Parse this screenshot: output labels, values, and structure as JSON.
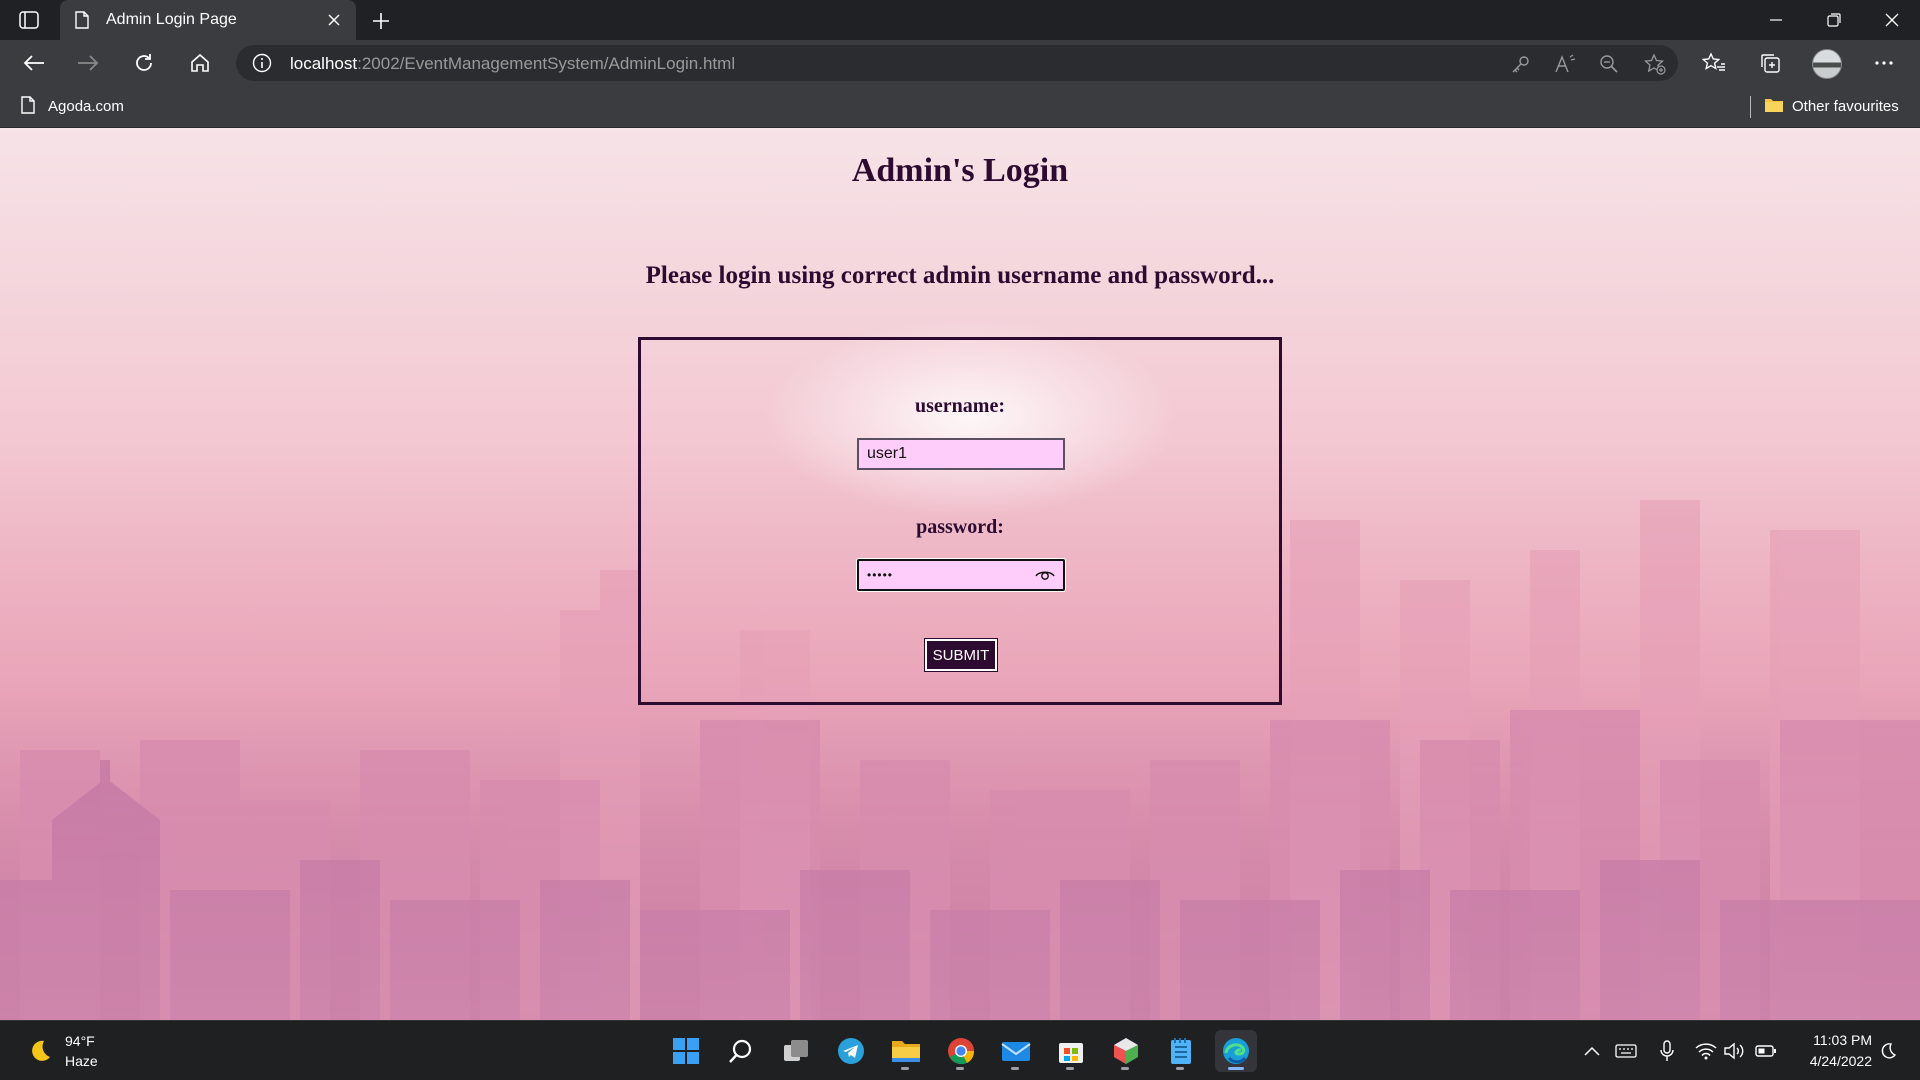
{
  "browser": {
    "tab": {
      "title": "Admin Login Page"
    },
    "address": {
      "host": "localhost",
      "path": ":2002/EventManagementSystem/AdminLogin.html"
    },
    "favorites": {
      "item": "Agoda.com",
      "other": "Other favourites"
    }
  },
  "page": {
    "title": "Admin's Login",
    "subtitle": "Please login using correct admin username and password...",
    "form": {
      "username_label": "username:",
      "username_value": "user1",
      "password_label": "password:",
      "password_value": "•••••",
      "submit_label": "SUBMIT"
    }
  },
  "taskbar": {
    "weather": {
      "temp": "94°F",
      "desc": "Haze"
    },
    "clock": {
      "time": "11:03 PM",
      "date": "4/24/2022"
    },
    "apps": [
      "start",
      "search",
      "task-view",
      "telegram",
      "file-explorer",
      "chrome",
      "mail",
      "microsoft-store",
      "app",
      "notepad",
      "edge"
    ]
  },
  "colors": {
    "accent": "#2d0a30",
    "input_bg": "#ffcdf9",
    "chrome_dark": "#202124",
    "chrome_mid": "#3b3c3f"
  }
}
